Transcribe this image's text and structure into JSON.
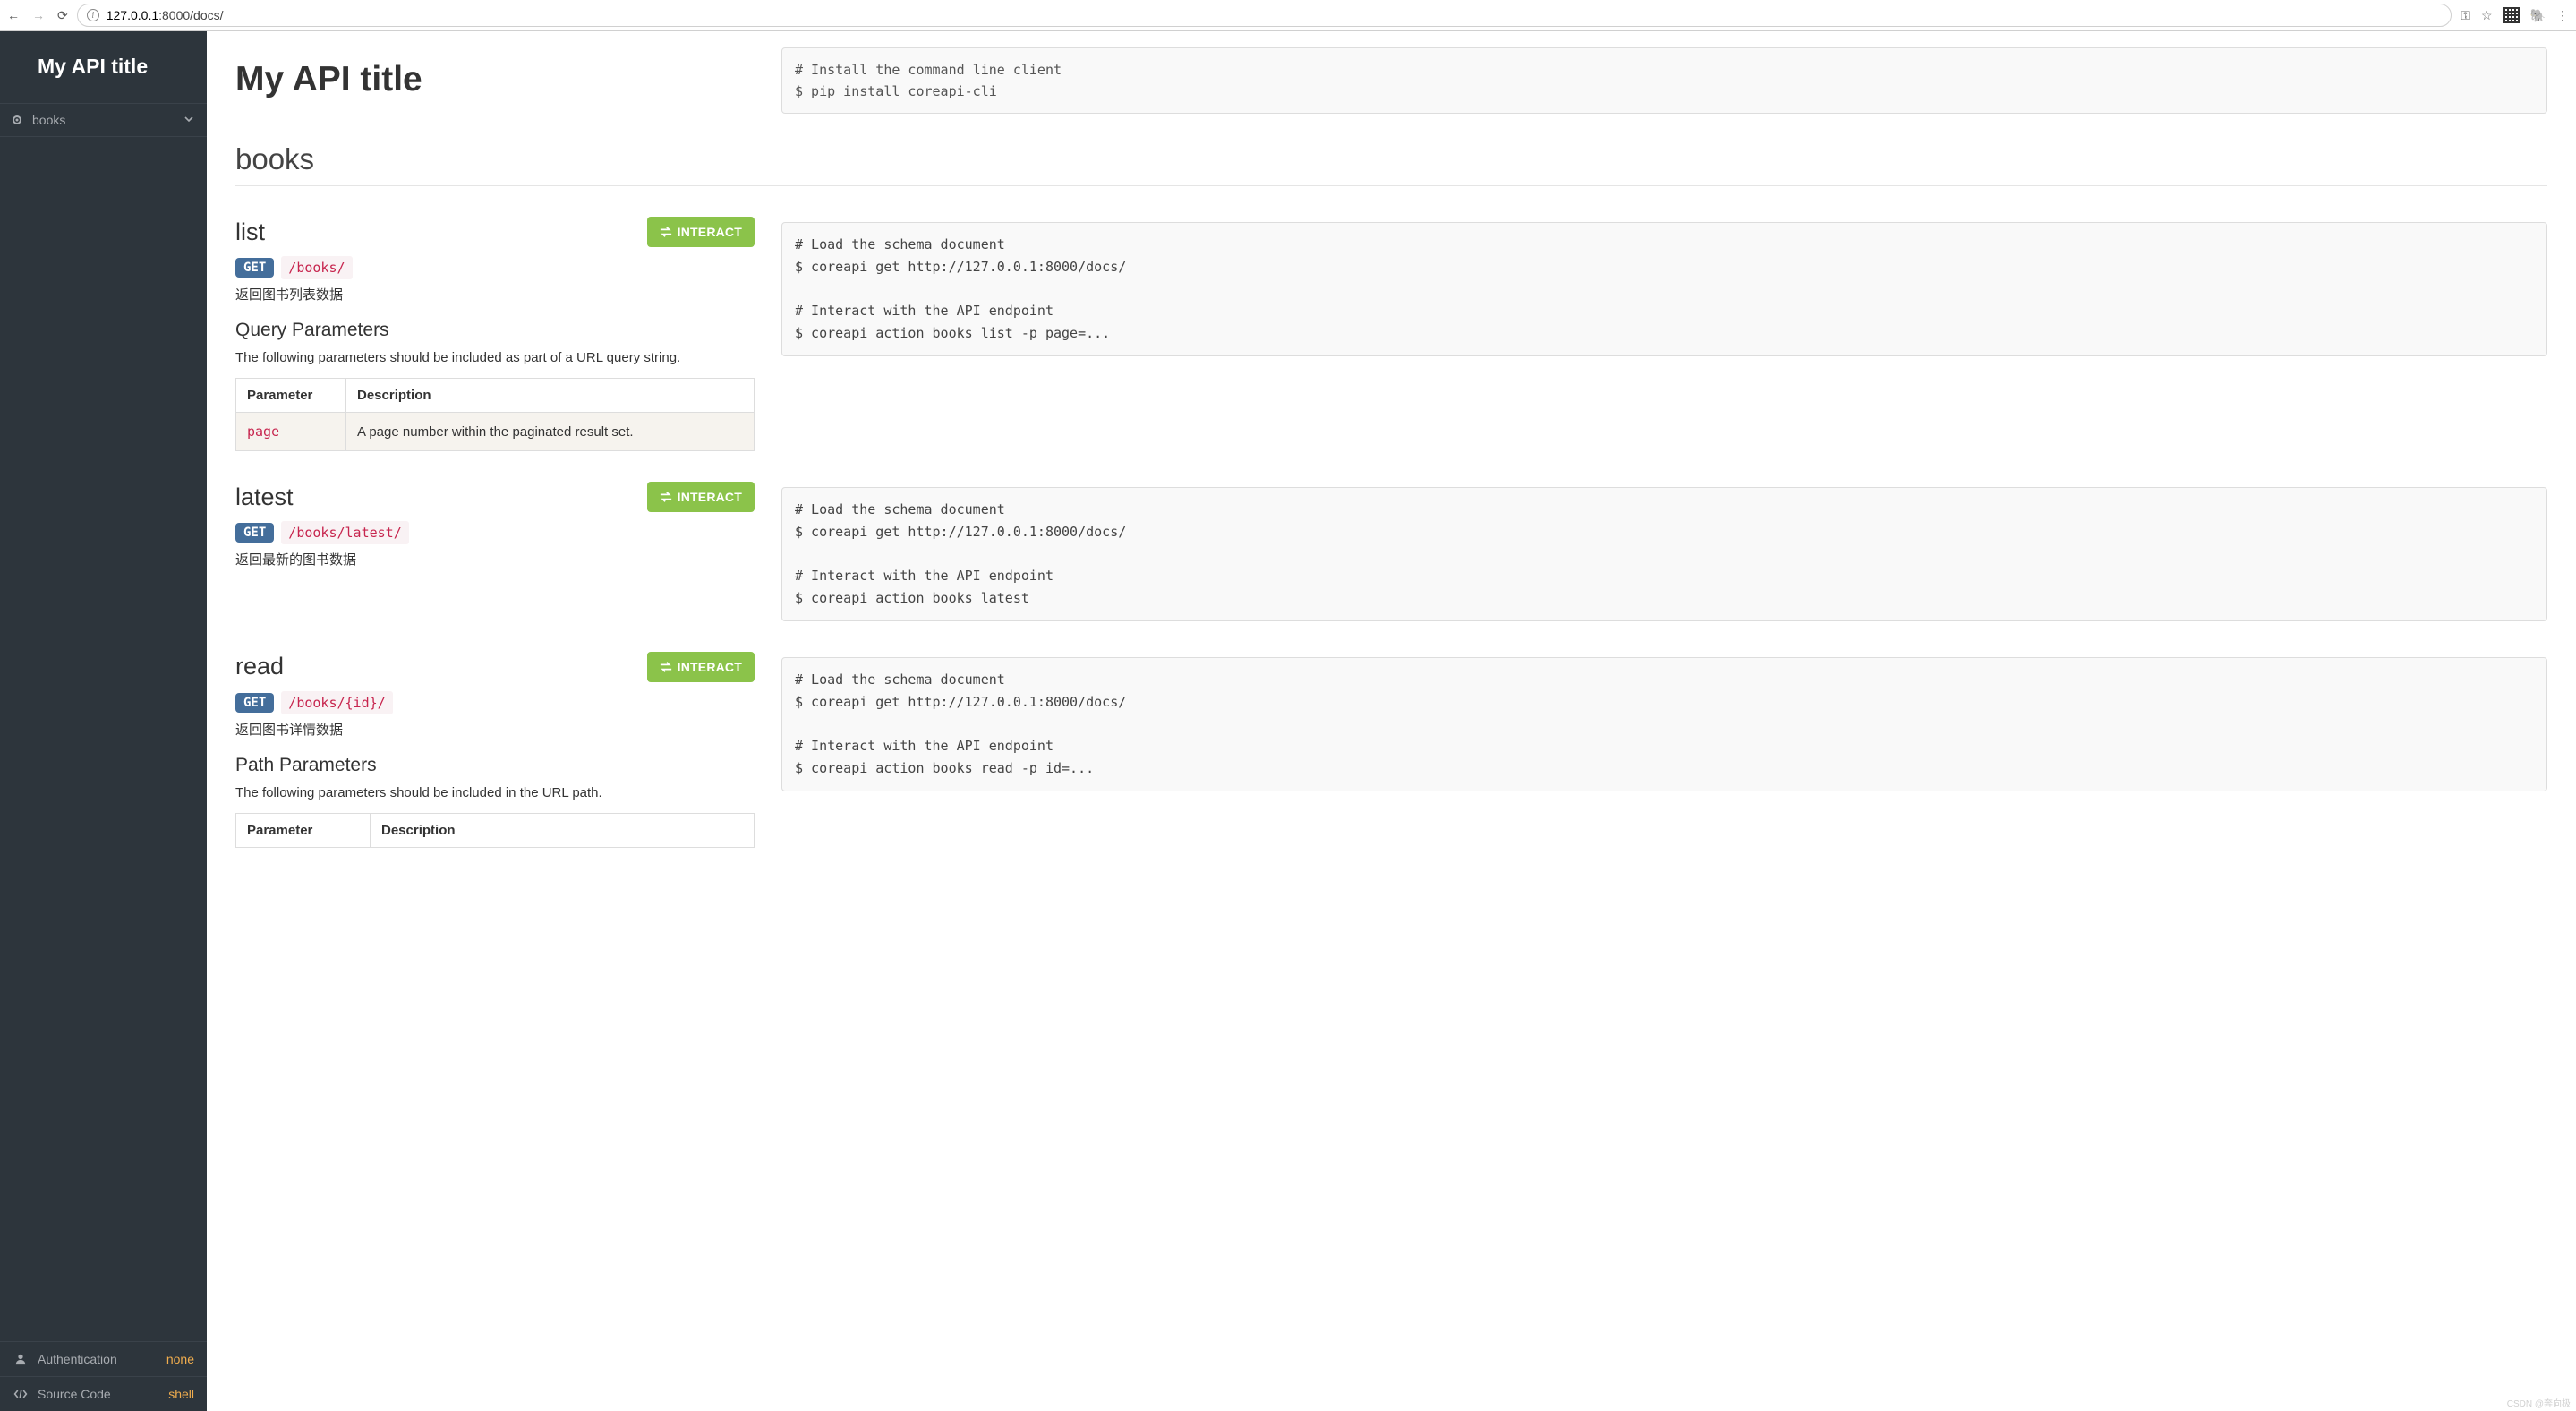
{
  "browser": {
    "url_host": "127.0.0.1",
    "url_port": ":8000/docs/"
  },
  "sidebar": {
    "title": "My API title",
    "items": [
      {
        "label": "books"
      }
    ],
    "footer": {
      "auth_label": "Authentication",
      "auth_value": "none",
      "source_label": "Source Code",
      "source_value": "shell"
    }
  },
  "header": {
    "title": "My API title",
    "install_code": "# Install the command line client\n$ pip install coreapi-cli"
  },
  "section": "books",
  "interact_label": "INTERACT",
  "table": {
    "col_param": "Parameter",
    "col_desc": "Description"
  },
  "endpoints": [
    {
      "name": "list",
      "method": "GET",
      "path": "/books/",
      "desc": "返回图书列表数据",
      "params_title": "Query Parameters",
      "params_intro": "The following parameters should be included as part of a URL query string.",
      "params": [
        {
          "name": "page",
          "desc": "A page number within the paginated result set."
        }
      ],
      "code": "# Load the schema document\n$ coreapi get http://127.0.0.1:8000/docs/\n\n# Interact with the API endpoint\n$ coreapi action books list -p page=..."
    },
    {
      "name": "latest",
      "method": "GET",
      "path": "/books/latest/",
      "desc": "返回最新的图书数据",
      "code": "# Load the schema document\n$ coreapi get http://127.0.0.1:8000/docs/\n\n# Interact with the API endpoint\n$ coreapi action books latest"
    },
    {
      "name": "read",
      "method": "GET",
      "path": "/books/{id}/",
      "desc": "返回图书详情数据",
      "params_title": "Path Parameters",
      "params_intro": "The following parameters should be included in the URL path.",
      "params": [],
      "code": "# Load the schema document\n$ coreapi get http://127.0.0.1:8000/docs/\n\n# Interact with the API endpoint\n$ coreapi action books read -p id=..."
    }
  ],
  "watermark": "CSDN @奔向极"
}
